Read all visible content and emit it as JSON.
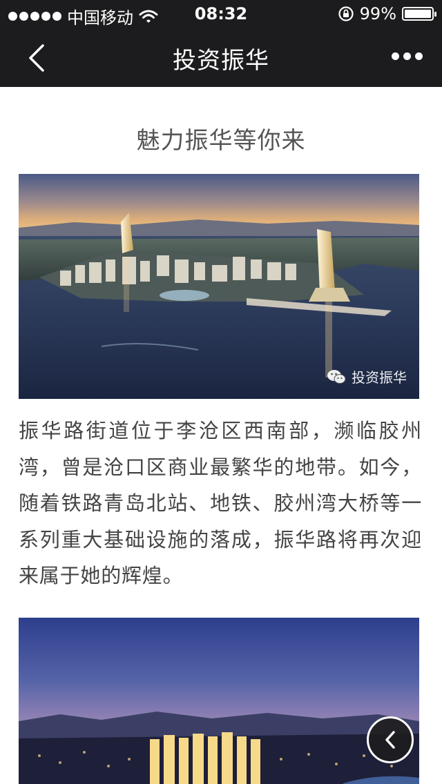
{
  "status_bar": {
    "carrier": "中国移动",
    "time": "08:32",
    "battery_text": "99%",
    "battery_level": 0.99,
    "icons": [
      "signal-dots-icon",
      "wifi-icon",
      "rotation-lock-icon",
      "battery-icon"
    ]
  },
  "nav": {
    "title": "投资振华",
    "back_icon": "chevron-left-icon",
    "more_icon": "more-dots-icon"
  },
  "article": {
    "title": "魅力振华等你来",
    "image_1": {
      "description_icon": "city-waterfront-night-photo",
      "watermark": "投资振华"
    },
    "paragraph": "振华路街道位于李沧区西南部，濒临胶州湾，曾是沧口区商业最繁华的地带。如今，随着铁路青岛北站、地铁、胶州湾大桥等一系列重大基础设施的落成，振华路将再次迎来属于她的辉煌。",
    "image_2": {
      "description_icon": "city-skyline-dusk-photo"
    }
  },
  "floating": {
    "back_icon": "chevron-left-icon"
  },
  "colors": {
    "bar_background": "#1c1c1e",
    "title_text": "#555555",
    "body_text": "#444444"
  }
}
